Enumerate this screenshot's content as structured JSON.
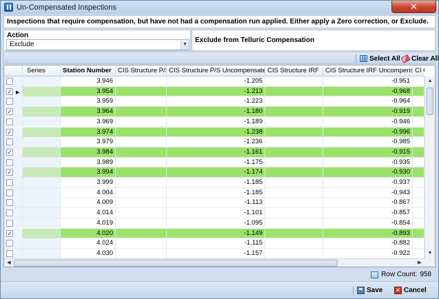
{
  "window": {
    "title": "Un-Compensated Inspections",
    "close_label": "✕"
  },
  "instruction": "Inspections that require compensation, but have not had a compensation run applied.  Either apply a Zero correction, or Exclude.",
  "action": {
    "label": "Action",
    "selected": "Exclude",
    "description": "Exclude from Telluric Compensation"
  },
  "toolbar": {
    "select_all": "Select All",
    "clear_all": "Clear All"
  },
  "grid": {
    "columns": [
      "",
      "Series",
      "Station Number",
      "CIS Structure P/S",
      "CIS Structure P/S Uncompensated",
      "CIS Structure IRF",
      "CIS Structure IRF Uncompensated",
      "CI C"
    ],
    "rows": [
      {
        "checked": false,
        "highlight": false,
        "current": false,
        "station": "3.946",
        "ps": "",
        "ps_unc": "-1.205",
        "irf": "",
        "irf_unc": "-0.951"
      },
      {
        "checked": true,
        "highlight": true,
        "current": true,
        "station": "3.954",
        "ps": "",
        "ps_unc": "-1.213",
        "irf": "",
        "irf_unc": "-0.968"
      },
      {
        "checked": false,
        "highlight": false,
        "current": false,
        "station": "3.959",
        "ps": "",
        "ps_unc": "-1.223",
        "irf": "",
        "irf_unc": "-0.964"
      },
      {
        "checked": true,
        "highlight": true,
        "current": false,
        "station": "3.964",
        "ps": "",
        "ps_unc": "-1.180",
        "irf": "",
        "irf_unc": "-0.919"
      },
      {
        "checked": false,
        "highlight": false,
        "current": false,
        "station": "3.969",
        "ps": "",
        "ps_unc": "-1.189",
        "irf": "",
        "irf_unc": "-0.946"
      },
      {
        "checked": true,
        "highlight": true,
        "current": false,
        "station": "3.974",
        "ps": "",
        "ps_unc": "-1.238",
        "irf": "",
        "irf_unc": "-0.996"
      },
      {
        "checked": false,
        "highlight": false,
        "current": false,
        "station": "3.979",
        "ps": "",
        "ps_unc": "-1.236",
        "irf": "",
        "irf_unc": "-0.985"
      },
      {
        "checked": true,
        "highlight": true,
        "current": false,
        "station": "3.984",
        "ps": "",
        "ps_unc": "-1.161",
        "irf": "",
        "irf_unc": "-0.915"
      },
      {
        "checked": false,
        "highlight": false,
        "current": false,
        "station": "3.989",
        "ps": "",
        "ps_unc": "-1.175",
        "irf": "",
        "irf_unc": "-0.935"
      },
      {
        "checked": true,
        "highlight": true,
        "current": false,
        "station": "3.994",
        "ps": "",
        "ps_unc": "-1.174",
        "irf": "",
        "irf_unc": "-0.930"
      },
      {
        "checked": false,
        "highlight": false,
        "current": false,
        "station": "3.999",
        "ps": "",
        "ps_unc": "-1.185",
        "irf": "",
        "irf_unc": "-0.937"
      },
      {
        "checked": false,
        "highlight": false,
        "current": false,
        "station": "4.004",
        "ps": "",
        "ps_unc": "-1.185",
        "irf": "",
        "irf_unc": "-0.943"
      },
      {
        "checked": false,
        "highlight": false,
        "current": false,
        "station": "4.009",
        "ps": "",
        "ps_unc": "-1.113",
        "irf": "",
        "irf_unc": "-0.867"
      },
      {
        "checked": false,
        "highlight": false,
        "current": false,
        "station": "4.014",
        "ps": "",
        "ps_unc": "-1.101",
        "irf": "",
        "irf_unc": "-0.857"
      },
      {
        "checked": false,
        "highlight": false,
        "current": false,
        "station": "4.019",
        "ps": "",
        "ps_unc": "-1.095",
        "irf": "",
        "irf_unc": "-0.854"
      },
      {
        "checked": true,
        "highlight": true,
        "current": false,
        "station": "4.020",
        "ps": "",
        "ps_unc": "-1.149",
        "irf": "",
        "irf_unc": "-0.893"
      },
      {
        "checked": false,
        "highlight": false,
        "current": false,
        "station": "4.024",
        "ps": "",
        "ps_unc": "-1.115",
        "irf": "",
        "irf_unc": "-0.882"
      },
      {
        "checked": false,
        "highlight": false,
        "current": false,
        "station": "4.030",
        "ps": "",
        "ps_unc": "-1.157",
        "irf": "",
        "irf_unc": "-0.922"
      }
    ]
  },
  "status": {
    "row_count_label": "Row Count:",
    "row_count": "958"
  },
  "footer": {
    "save": "Save",
    "cancel": "Cancel"
  },
  "colors": {
    "highlight_row": "#9be26b",
    "window_bg": "#cfdeee"
  }
}
